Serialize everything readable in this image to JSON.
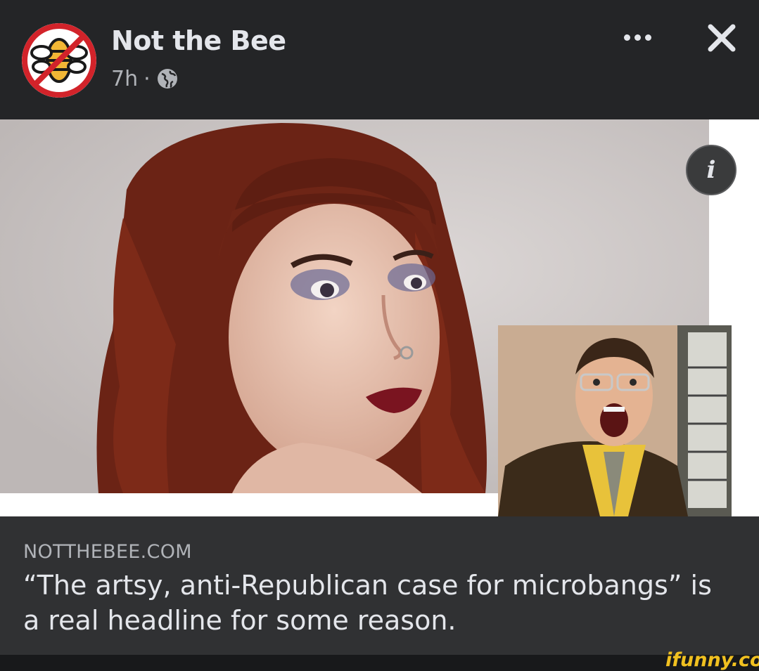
{
  "post": {
    "page_name": "Not the Bee",
    "time": "7h",
    "separator": "·",
    "privacy_icon": "globe-icon",
    "avatar_icon": "no-bee-logo",
    "more_icon": "more-dots-icon",
    "close_icon": "close-icon"
  },
  "link_preview": {
    "info_label": "i",
    "domain": "NOTTHEBEE.COM",
    "headline": "“The artsy, anti-Republican case for microbangs” is a real headline for some reason."
  },
  "watermark": "ifunny.co",
  "colors": {
    "header_bg": "#242527",
    "caption_bg": "#303133",
    "text_primary": "#e4e6eb",
    "text_secondary": "#b0b3b8",
    "logo_red": "#d2232a",
    "watermark": "#f0c020"
  }
}
